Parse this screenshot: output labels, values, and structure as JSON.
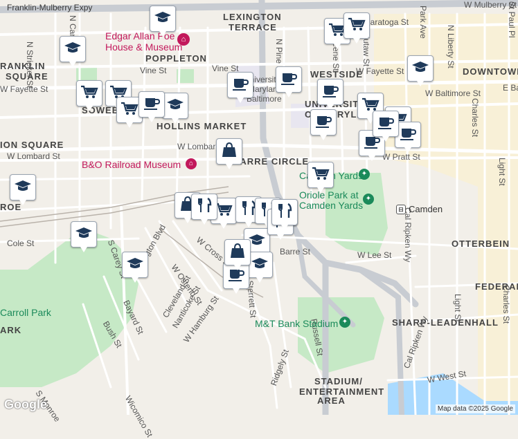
{
  "map": {
    "background": "#f2efe9",
    "colors": {
      "road": "#ffffff",
      "highway": "#c8ccd2",
      "park": "#c6e9c6",
      "campus": "#fdf0c8",
      "water": "#aadaff",
      "marker_fill": "#1f3a5a"
    },
    "highways": [
      {
        "label": "Franklin-Mulberry Expy"
      }
    ],
    "neighborhoods": [
      {
        "label": "LEXINGTON"
      },
      {
        "label": "TERRACE"
      },
      {
        "label": "POPPLETON"
      },
      {
        "label": "RANKLIN"
      },
      {
        "label": "SQUARE"
      },
      {
        "label": "WESTSIDE"
      },
      {
        "label": "DOWNTOWN"
      },
      {
        "label": "HOLLINS MARKET"
      },
      {
        "label": "SOWEB"
      },
      {
        "label": "ION SQUARE"
      },
      {
        "label": "BARRE CIRCLE"
      },
      {
        "label": "OTTERBEIN"
      },
      {
        "label": "FEDERAL"
      },
      {
        "label": "SHARP-LEADENHALL"
      },
      {
        "label": "STADIUM/"
      },
      {
        "label": "ENTERTAINMENT"
      },
      {
        "label": "AREA"
      },
      {
        "label": "ARK"
      },
      {
        "label": "ROE"
      }
    ],
    "streets": [
      {
        "label": "N Stricker St"
      },
      {
        "label": "N Carey St"
      },
      {
        "label": "Vine St"
      },
      {
        "label": "Vine St"
      },
      {
        "label": "W Fayette St"
      },
      {
        "label": "W Fayette St"
      },
      {
        "label": "W Baltimore St"
      },
      {
        "label": "E Bal"
      },
      {
        "label": "W Lombard St"
      },
      {
        "label": "W Lombard St"
      },
      {
        "label": "W Pratt St"
      },
      {
        "label": "N Pine St"
      },
      {
        "label": "N Greene St"
      },
      {
        "label": "N Eutaw St"
      },
      {
        "label": "Park Ave"
      },
      {
        "label": "N Liberty St"
      },
      {
        "label": "St Paul Pl"
      },
      {
        "label": "Charles St"
      },
      {
        "label": "Light St"
      },
      {
        "label": "Cal Ripken Wy"
      },
      {
        "label": "Cal Ripken Wy"
      },
      {
        "label": "W Lee St"
      },
      {
        "label": "W Ostend St"
      },
      {
        "label": "Washington Blvd"
      },
      {
        "label": "W Cross St"
      },
      {
        "label": "Cleveland St"
      },
      {
        "label": "Nanticoke St"
      },
      {
        "label": "W Hamburg St"
      },
      {
        "label": "Bayard St"
      },
      {
        "label": "Bush St"
      },
      {
        "label": "S Carey St"
      },
      {
        "label": "Cole St"
      },
      {
        "label": "Sterrett St"
      },
      {
        "label": "Russell St"
      },
      {
        "label": "Ridgely St"
      },
      {
        "label": "W West St"
      },
      {
        "label": "S Monroe"
      },
      {
        "label": "Wicomico St"
      },
      {
        "label": "Charles St"
      },
      {
        "label": "Light St"
      },
      {
        "label": "W Saratoga St"
      },
      {
        "label": "W Mulberry St"
      },
      {
        "label": "Barre St"
      },
      {
        "label": "Camden"
      }
    ],
    "pois": [
      {
        "label": "Edgar Allan Poe",
        "icon": "museum-icon"
      },
      {
        "label": "House & Museum",
        "icon": ""
      },
      {
        "label": "B&O Railroad Museum",
        "icon": "museum-icon"
      },
      {
        "label": "Camden Yards",
        "icon": "stadium-icon"
      },
      {
        "label": "Oriole Park at",
        "icon": ""
      },
      {
        "label": "Camden Yards",
        "icon": "stadium-icon"
      },
      {
        "label": "M&T Bank Stadium",
        "icon": "stadium-icon"
      },
      {
        "label": "Carroll Park",
        "icon": ""
      },
      {
        "label": "University",
        "icon": ""
      },
      {
        "label": "Maryland",
        "icon": ""
      },
      {
        "label": "Baltimore",
        "icon": ""
      },
      {
        "label": "UNIVERSITY",
        "icon": ""
      },
      {
        "label": "OF MARYLAND",
        "icon": ""
      }
    ],
    "markers": [
      {
        "type": "graduation-cap-icon"
      },
      {
        "type": "graduation-cap-icon"
      },
      {
        "type": "graduation-cap-icon"
      },
      {
        "type": "graduation-cap-icon"
      },
      {
        "type": "graduation-cap-icon"
      },
      {
        "type": "graduation-cap-icon"
      },
      {
        "type": "graduation-cap-icon"
      },
      {
        "type": "graduation-cap-icon"
      },
      {
        "type": "graduation-cap-icon"
      },
      {
        "type": "shopping-cart-icon"
      },
      {
        "type": "shopping-cart-icon"
      },
      {
        "type": "shopping-cart-icon"
      },
      {
        "type": "shopping-cart-icon"
      },
      {
        "type": "shopping-cart-icon"
      },
      {
        "type": "shopping-cart-icon"
      },
      {
        "type": "shopping-cart-icon"
      },
      {
        "type": "shopping-cart-icon"
      },
      {
        "type": "shopping-cart-icon"
      },
      {
        "type": "coffee-cup-icon"
      },
      {
        "type": "coffee-cup-icon"
      },
      {
        "type": "coffee-cup-icon"
      },
      {
        "type": "coffee-cup-icon"
      },
      {
        "type": "coffee-cup-icon"
      },
      {
        "type": "coffee-cup-icon"
      },
      {
        "type": "coffee-cup-icon"
      },
      {
        "type": "coffee-cup-icon"
      },
      {
        "type": "coffee-cup-icon"
      },
      {
        "type": "shopping-bag-icon"
      },
      {
        "type": "shopping-bag-icon"
      },
      {
        "type": "shopping-bag-icon"
      },
      {
        "type": "shopping-bag-icon"
      },
      {
        "type": "fork-knife-icon"
      },
      {
        "type": "fork-knife-icon"
      },
      {
        "type": "fork-knife-icon"
      },
      {
        "type": "fork-knife-icon"
      },
      {
        "type": "fork-knife-icon"
      }
    ],
    "footer": {
      "google_logo": "Google",
      "attribution": "Map data ©2025 Google"
    }
  }
}
